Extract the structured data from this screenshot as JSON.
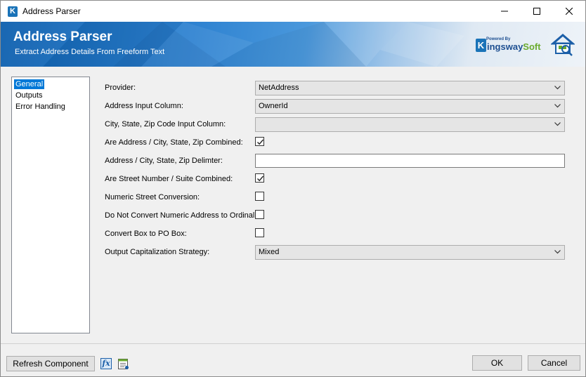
{
  "window": {
    "title": "Address Parser",
    "app_icon_letter": "K"
  },
  "banner": {
    "title": "Address Parser",
    "subtitle": "Extract Address Details From Freeform Text",
    "logo_powered": "Powered By",
    "logo_k": "K",
    "logo_part1": "ingsway",
    "logo_part2": "Soft"
  },
  "nav": {
    "items": [
      {
        "label": "General",
        "selected": true
      },
      {
        "label": "Outputs",
        "selected": false
      },
      {
        "label": "Error Handling",
        "selected": false
      }
    ]
  },
  "form": {
    "provider_label": "Provider:",
    "provider_value": "NetAddress",
    "address_input_label": "Address Input Column:",
    "address_input_value": "OwnerId",
    "csz_input_label": "City, State, Zip Code Input Column:",
    "csz_input_value": "",
    "combined_label": "Are Address / City, State, Zip Combined:",
    "combined_checked": true,
    "delimiter_label": "Address / City, State, Zip Delimter:",
    "delimiter_value": "",
    "street_suite_label": "Are Street Number / Suite Combined:",
    "street_suite_checked": true,
    "numeric_street_label": "Numeric Street Conversion:",
    "numeric_street_checked": false,
    "ordinal_label": "Do Not Convert Numeric Address to Ordinal:",
    "ordinal_checked": false,
    "pobox_label": "Convert Box to PO Box:",
    "pobox_checked": false,
    "capitalization_label": "Output Capitalization Strategy:",
    "capitalization_value": "Mixed"
  },
  "footer": {
    "refresh_label": "Refresh Component",
    "fx_label": "fx",
    "ok_label": "OK",
    "cancel_label": "Cancel"
  },
  "colors": {
    "selection": "#0078d7",
    "brand_blue": "#1a73b8",
    "brand_green": "#6aab2e"
  }
}
